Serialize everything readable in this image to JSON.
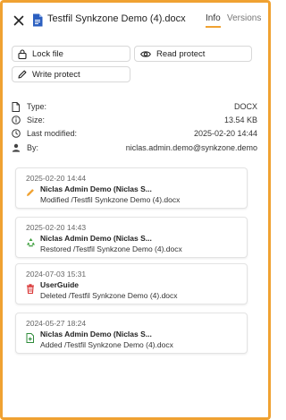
{
  "header": {
    "file_title": "Testfil Synkzone Demo (4).docx",
    "tabs": [
      {
        "label": "Info",
        "active": true
      },
      {
        "label": "Versions",
        "active": false
      }
    ]
  },
  "actions": {
    "lock_label": "Lock file",
    "read_protect_label": "Read protect",
    "write_protect_label": "Write protect"
  },
  "properties": [
    {
      "key": "Type:",
      "value": "DOCX",
      "icon": "file-icon"
    },
    {
      "key": "Size:",
      "value": "13.54 KB",
      "icon": "info-icon"
    },
    {
      "key": "Last modified:",
      "value": "2025-02-20 14:44",
      "icon": "clock-icon"
    },
    {
      "key": "By:",
      "value": "niclas.admin.demo@synkzone.demo",
      "icon": "user-icon"
    }
  ],
  "activity": [
    {
      "date": "2025-02-20 14:44",
      "user": "Niclas Admin Demo (Niclas S...",
      "action": "Modified /Testfil Synkzone Demo (4).docx",
      "icon": "pencil-icon",
      "color": "#f0a232"
    },
    {
      "date": "2025-02-20 14:43",
      "user": "Niclas Admin Demo (Niclas S...",
      "action": "Restored /Testfil Synkzone Demo (4).docx",
      "icon": "recycle-icon",
      "color": "#3a9d3a"
    },
    {
      "date": "2024-07-03 15:31",
      "user": "UserGuide",
      "action": "Deleted /Testfil Synkzone Demo (4).docx",
      "icon": "trash-icon",
      "color": "#d93636"
    },
    {
      "date": "2024-05-27 18:24",
      "user": "Niclas Admin Demo (Niclas S...",
      "action": "Added /Testfil Synkzone Demo (4).docx",
      "icon": "file-add-icon",
      "color": "#2e8b3a"
    }
  ],
  "colors": {
    "accent": "#f0a232",
    "border": "#d8d8d8"
  }
}
